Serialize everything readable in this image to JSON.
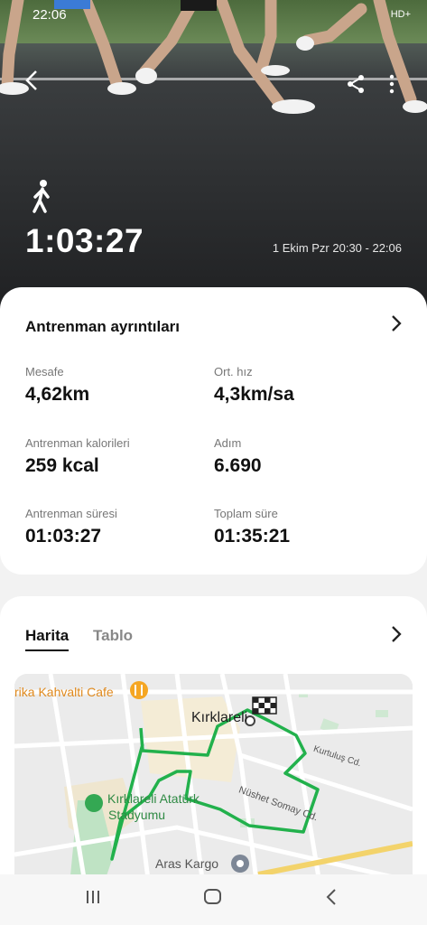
{
  "status_bar": {
    "time": "22:06",
    "network": "HD+"
  },
  "hero": {
    "duration": "1:03:27",
    "date_range": "1 Ekim Pzr 20:30 - 22:06",
    "back_icon": "chevron-left-icon",
    "share_icon": "share-icon",
    "menu_icon": "more-vertical-icon",
    "activity_icon": "walking-icon"
  },
  "details": {
    "title": "Antrenman ayrıntıları",
    "metrics": [
      {
        "label": "Mesafe",
        "value": "4,62",
        "unit": "km"
      },
      {
        "label": "Ort. hız",
        "value": "4,3",
        "unit": "km/sa"
      },
      {
        "label": "Antrenman kalorileri",
        "value": "259",
        "unit": "kcal"
      },
      {
        "label": "Adım",
        "value": "6.690",
        "unit": ""
      },
      {
        "label": "Antrenman süresi",
        "value": "01:03:27",
        "unit": ""
      },
      {
        "label": "Toplam süre",
        "value": "01:35:21",
        "unit": ""
      }
    ]
  },
  "map_section": {
    "tabs": [
      "Harita",
      "Tablo"
    ],
    "active_tab": "Harita",
    "labels": {
      "cafe": "rika Kahvalti Cafe",
      "city": "Kırklareli",
      "stadium_line1": "Kırklareli Atatürk",
      "stadium_line2": "Stadyumu",
      "street1": "Kurtuluş Cd.",
      "street2": "Nüshet Somay Cd.",
      "cargo": "Aras Kargo"
    },
    "route_color": "#22b14c"
  },
  "navbar": {
    "recent": "recent-apps-icon",
    "home": "home-icon",
    "back": "back-icon"
  }
}
